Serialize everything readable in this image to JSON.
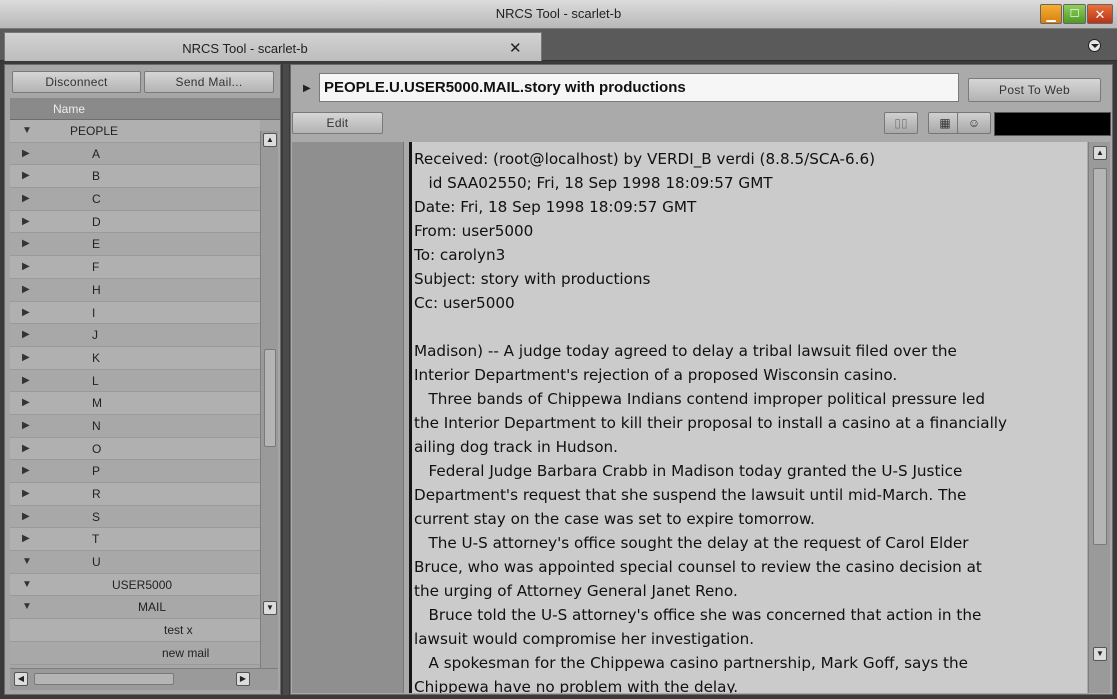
{
  "window": {
    "title": "NRCS Tool - scarlet-b"
  },
  "tab": {
    "label": "NRCS Tool - scarlet-b",
    "close_glyph": "✕"
  },
  "left_panel": {
    "disconnect_label": "Disconnect",
    "send_mail_label": "Send Mail...",
    "column_header": "Name",
    "tree": [
      {
        "label": "PEOPLE",
        "expanded": true
      },
      {
        "label": "A",
        "expanded": false
      },
      {
        "label": "B",
        "expanded": false
      },
      {
        "label": "C",
        "expanded": false
      },
      {
        "label": "D",
        "expanded": false
      },
      {
        "label": "E",
        "expanded": false
      },
      {
        "label": "F",
        "expanded": false
      },
      {
        "label": "H",
        "expanded": false
      },
      {
        "label": "I",
        "expanded": false
      },
      {
        "label": "J",
        "expanded": false
      },
      {
        "label": "K",
        "expanded": false
      },
      {
        "label": "L",
        "expanded": false
      },
      {
        "label": "M",
        "expanded": false
      },
      {
        "label": "N",
        "expanded": false
      },
      {
        "label": "O",
        "expanded": false
      },
      {
        "label": "P",
        "expanded": false
      },
      {
        "label": "R",
        "expanded": false
      },
      {
        "label": "S",
        "expanded": false
      },
      {
        "label": "T",
        "expanded": false
      },
      {
        "label": "U",
        "expanded": true
      },
      {
        "label": "USER5000",
        "expanded": true
      },
      {
        "label": "MAIL",
        "expanded": true
      },
      {
        "label": "test x",
        "expanded": null
      },
      {
        "label": "new mail",
        "expanded": null
      }
    ]
  },
  "editor": {
    "path": "PEOPLE.U.USER5000.MAIL.story with productions",
    "post_label": "Post To Web",
    "edit_label": "Edit",
    "icons": [
      "split-view-icon",
      "grid-icon",
      "people-icon"
    ],
    "body_lines": [
      "Received: (root@localhost) by VERDI_B verdi (8.8.5/SCA-6.6)",
      "   id SAA02550; Fri, 18 Sep 1998 18:09:57 GMT",
      "Date: Fri, 18 Sep 1998 18:09:57 GMT",
      "From: user5000",
      "To: carolyn3",
      "Subject: story with productions",
      "Cc: user5000",
      "",
      "Madison) -- A judge today agreed to delay a tribal lawsuit filed over the",
      "Interior Department's rejection of a proposed Wisconsin casino.",
      "   Three bands of Chippewa Indians contend improper political pressure led",
      "the Interior Department to kill their proposal to install a casino at a financially",
      "ailing dog track in Hudson.",
      "   Federal Judge Barbara Crabb in Madison today granted the U-S Justice",
      "Department's request that she suspend the lawsuit until mid-March. The",
      "current stay on the case was set to expire tomorrow.",
      "   The U-S attorney's office sought the delay at the request of Carol Elder",
      "Bruce, who was appointed special counsel to review the casino decision at",
      "the urging of Attorney General Janet Reno.",
      "   Bruce told the U-S attorney's office she was concerned that action in the",
      "lawsuit would compromise her investigation.",
      "   A spokesman for the Chippewa casino partnership, Mark Goff, says the",
      "Chippewa have no problem with the delay."
    ]
  }
}
